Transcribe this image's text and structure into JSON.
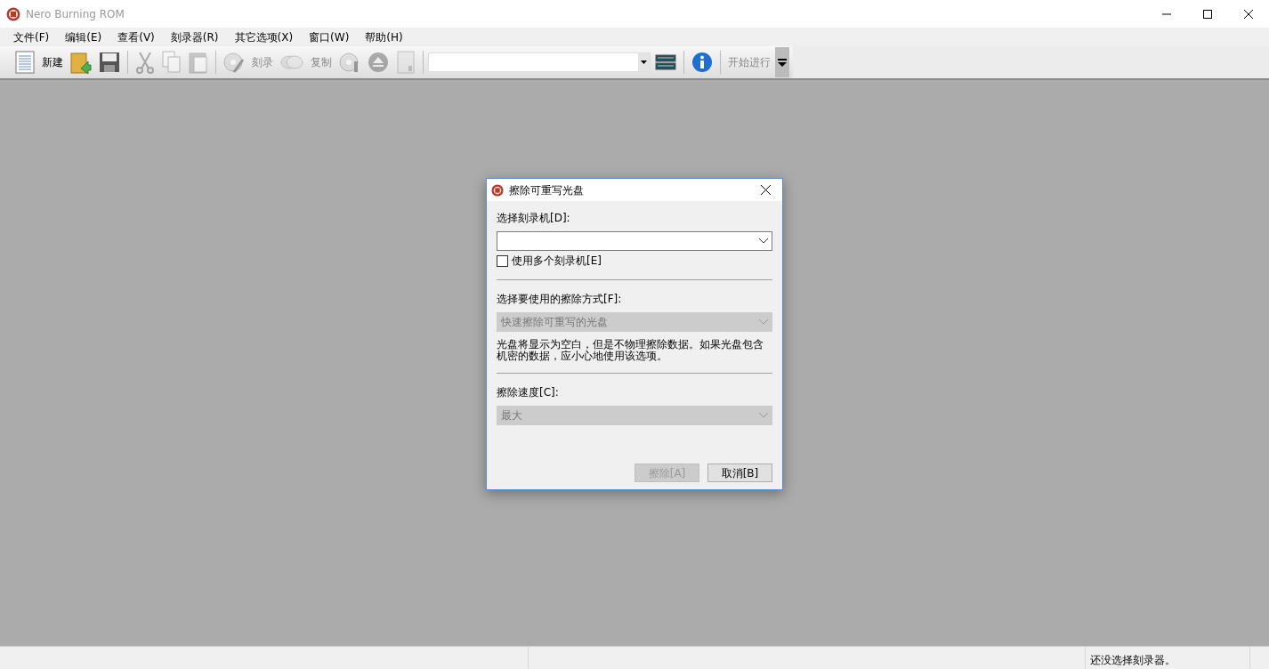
{
  "window": {
    "title": "Nero Burning ROM"
  },
  "menu": [
    "文件(F)",
    "编辑(E)",
    "查看(V)",
    "刻录器(R)",
    "其它选项(X)",
    "窗口(W)",
    "帮助(H)"
  ],
  "toolbar": [
    {
      "kind": "icon",
      "disabled": false
    },
    {
      "kind": "label",
      "text": "新建",
      "disabled": false
    },
    {
      "kind": "icon",
      "disabled": false
    },
    {
      "kind": "icon",
      "disabled": false
    },
    {
      "kind": "separator"
    },
    {
      "kind": "icon",
      "disabled": true
    },
    {
      "kind": "icon",
      "disabled": true
    },
    {
      "kind": "icon",
      "disabled": true
    },
    {
      "kind": "separator"
    },
    {
      "kind": "icon",
      "disabled": true
    },
    {
      "kind": "label",
      "text": "刻录",
      "disabled": true
    },
    {
      "kind": "icon",
      "disabled": true
    },
    {
      "kind": "label",
      "text": "复制",
      "disabled": true
    },
    {
      "kind": "icon",
      "disabled": true
    },
    {
      "kind": "icon",
      "disabled": true
    },
    {
      "kind": "icon",
      "disabled": true
    },
    {
      "kind": "separator"
    },
    {
      "kind": "combo"
    },
    {
      "kind": "icon",
      "disabled": false
    },
    {
      "kind": "separator"
    },
    {
      "kind": "icon",
      "disabled": false
    },
    {
      "kind": "separator"
    },
    {
      "kind": "label",
      "text": "开始进行",
      "disabled": true
    }
  ],
  "dialog": {
    "title": "擦除可重写光盘",
    "items": [
      {
        "kind": "label",
        "text": "选择刻录机[D]:"
      },
      {
        "kind": "select",
        "value": "",
        "disabled": false
      },
      {
        "kind": "checkbox",
        "text": "使用多个刻录机[E]",
        "checked": false
      },
      {
        "kind": "divider"
      },
      {
        "kind": "label",
        "text": "选择要使用的擦除方式[F]:"
      },
      {
        "kind": "select",
        "value": "快速擦除可重写的光盘",
        "disabled": true
      },
      {
        "kind": "note",
        "text": "光盘将显示为空白，但是不物理擦除数据。如果光盘包含机密的数据，应小心地使用该选项。"
      },
      {
        "kind": "divider"
      },
      {
        "kind": "label",
        "text": "擦除速度[C]:"
      },
      {
        "kind": "select",
        "value": "最大",
        "disabled": true
      }
    ],
    "buttons": [
      {
        "label": "擦除[A]",
        "disabled": true
      },
      {
        "label": "取消[B]",
        "disabled": false
      }
    ]
  },
  "status_bar": {
    "message": "还没选择刻录器。"
  }
}
